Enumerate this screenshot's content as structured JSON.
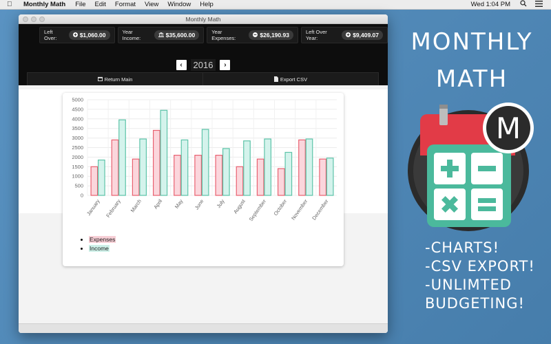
{
  "menubar": {
    "app_name": "Monthly Math",
    "items": [
      "File",
      "Edit",
      "Format",
      "View",
      "Window",
      "Help"
    ],
    "clock": "Wed 1:04 PM"
  },
  "window": {
    "title": "Monthly Math"
  },
  "stats": {
    "left_over": {
      "label": "Left Over:",
      "value": "$1,060.00",
      "icon": "plus-circle-icon"
    },
    "year_income": {
      "label": "Year Income:",
      "value": "$35,600.00",
      "icon": "bank-icon"
    },
    "year_expenses": {
      "label": "Year Expenses:",
      "value": "$26,190.93",
      "icon": "minus-circle-icon"
    },
    "left_over_year": {
      "label": "Left Over Year:",
      "value": "$9,409.07",
      "icon": "plus-circle-icon"
    }
  },
  "year_nav": {
    "year": "2016",
    "prev": "‹",
    "next": "›"
  },
  "actions": {
    "return_main": "Return Main",
    "export_csv": "Export CSV"
  },
  "legend": {
    "expenses": "Expenses",
    "income": "Income"
  },
  "promo": {
    "title_line1": "MONTHLY",
    "title_line2": "MATH",
    "logo_letter": "M",
    "features": [
      "-CHARTS!",
      "-CSV EXPORT!",
      "-UNLIMTED",
      "BUDGETING!"
    ]
  },
  "colors": {
    "expenses_fill": "#fbd6dc",
    "expenses_stroke": "#e8606f",
    "income_fill": "#d4f3ec",
    "income_stroke": "#5cc3a8",
    "background": "#4f88b7"
  },
  "chart_data": {
    "type": "bar",
    "categories": [
      "January",
      "February",
      "March",
      "April",
      "May",
      "June",
      "July",
      "August",
      "September",
      "October",
      "November",
      "December"
    ],
    "series": [
      {
        "name": "Expenses",
        "values": [
          1500,
          2900,
          1900,
          3400,
          2100,
          2100,
          2100,
          1500,
          1900,
          1400,
          2900,
          1900
        ]
      },
      {
        "name": "Income",
        "values": [
          1850,
          3950,
          2950,
          4450,
          2900,
          3450,
          2450,
          2850,
          2950,
          2250,
          2950,
          1950
        ]
      }
    ],
    "yticks": [
      "0",
      "500",
      "1000",
      "1500",
      "2000",
      "2500",
      "3000",
      "3500",
      "4000",
      "4500",
      "5000"
    ],
    "ylim": [
      0,
      5000
    ],
    "grid": true
  }
}
